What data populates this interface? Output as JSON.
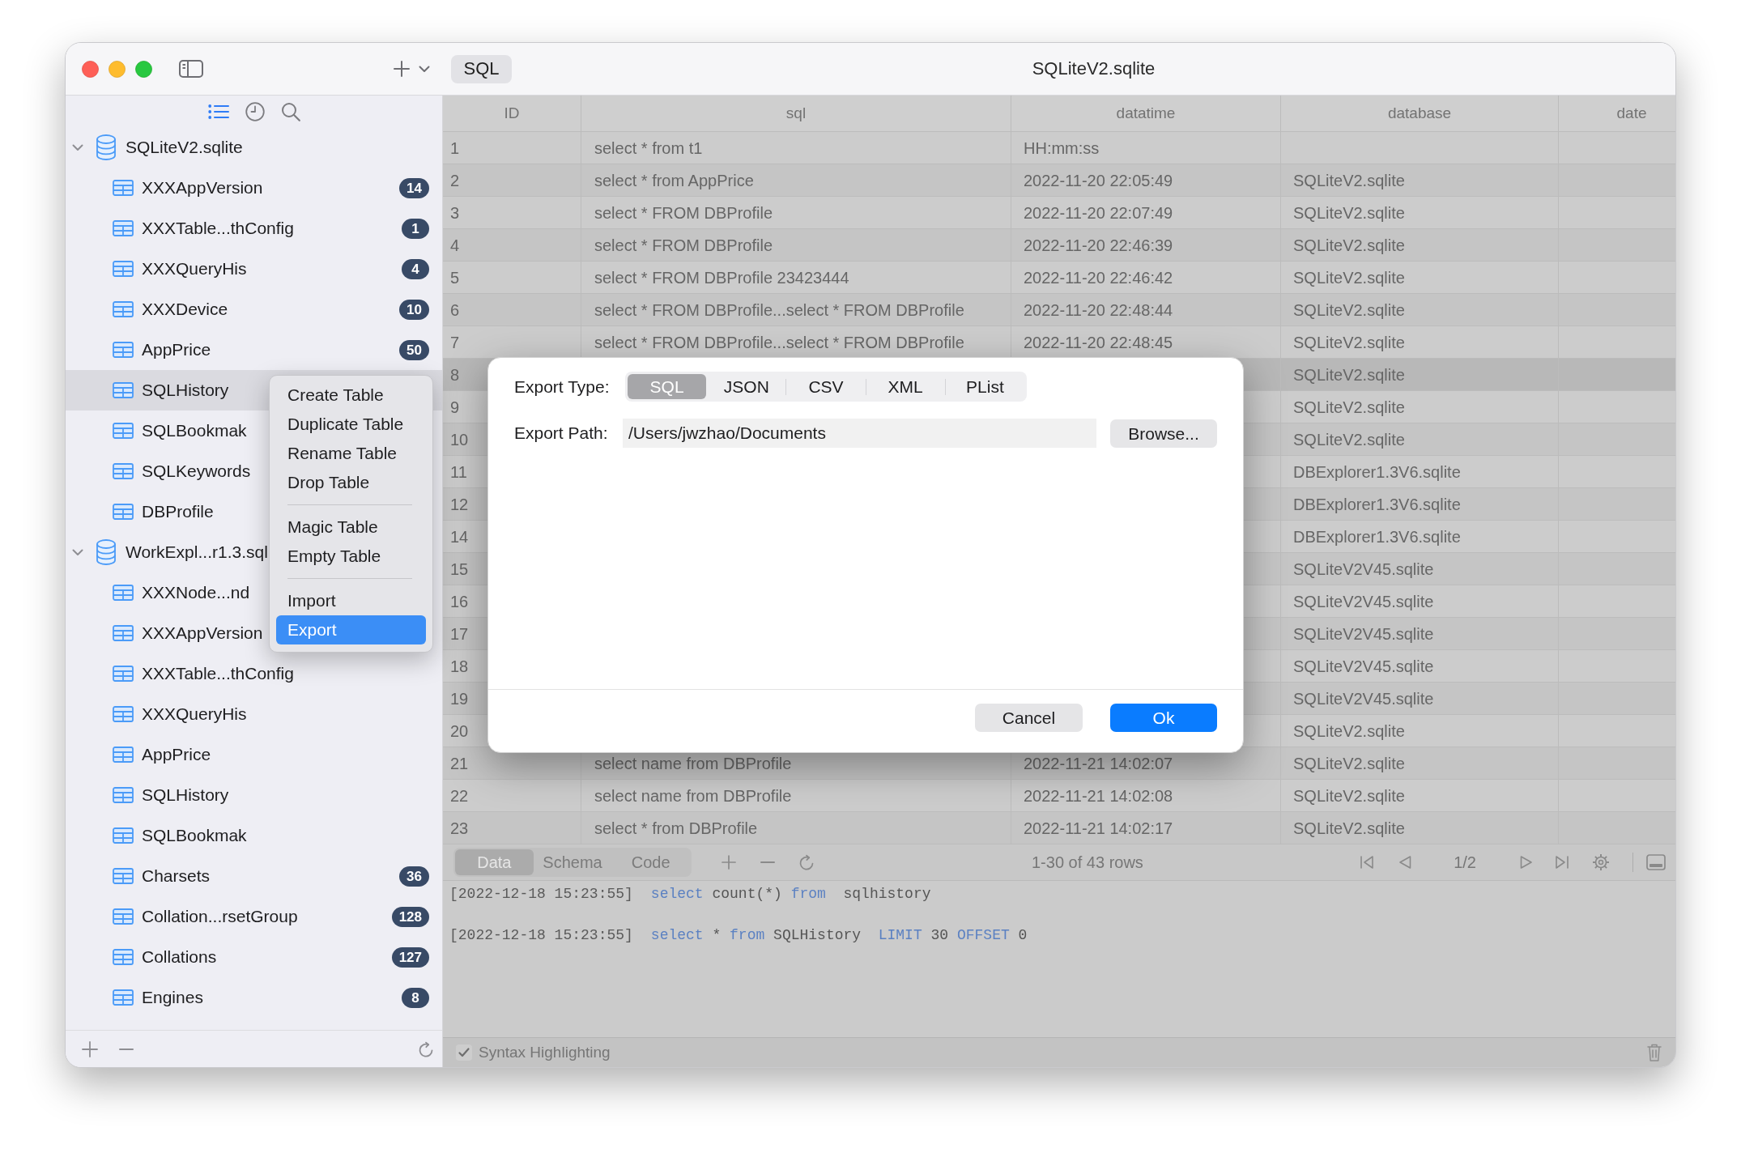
{
  "window": {
    "title": "SQLiteV2.sqlite",
    "sql_button": "SQL"
  },
  "sidebar": {
    "views": [
      {
        "selected": true
      },
      {
        "selected": false
      },
      {
        "selected": false
      }
    ],
    "tree": [
      {
        "label": "SQLiteV2.sqlite",
        "expanded": true,
        "selected": false,
        "children": [
          {
            "label": "XXXAppVersion",
            "count": "14",
            "selected": false
          },
          {
            "label": "XXXTable...thConfig",
            "count": "1",
            "selected": false
          },
          {
            "label": "XXXQueryHis",
            "count": "4",
            "selected": false
          },
          {
            "label": "XXXDevice",
            "count": "10",
            "selected": false
          },
          {
            "label": "AppPrice",
            "count": "50",
            "selected": false
          },
          {
            "label": "SQLHistory",
            "selected": true
          },
          {
            "label": "SQLBookmak",
            "selected": false
          },
          {
            "label": "SQLKeywords",
            "selected": false
          },
          {
            "label": "DBProfile",
            "selected": false
          }
        ]
      },
      {
        "label": "WorkExpl...r1.3.sql",
        "expanded": true,
        "selected": false,
        "children": [
          {
            "label": "XXXNode...nd",
            "selected": false
          },
          {
            "label": "XXXAppVersion",
            "selected": false
          },
          {
            "label": "XXXTable...thConfig",
            "selected": false
          },
          {
            "label": "XXXQueryHis",
            "selected": false
          },
          {
            "label": "AppPrice",
            "selected": false
          },
          {
            "label": "SQLHistory",
            "selected": false
          },
          {
            "label": "SQLBookmak",
            "selected": false
          },
          {
            "label": "Charsets",
            "count": "36",
            "selected": false
          },
          {
            "label": "Collation...rsetGroup",
            "count": "128",
            "selected": false
          },
          {
            "label": "Collations",
            "count": "127",
            "selected": false
          },
          {
            "label": "Engines",
            "count": "8",
            "selected": false
          }
        ]
      }
    ]
  },
  "context_menu": {
    "groups": [
      [
        {
          "label": "Create Table",
          "highlighted": false
        },
        {
          "label": "Duplicate Table",
          "highlighted": false
        },
        {
          "label": "Rename Table",
          "highlighted": false
        },
        {
          "label": "Drop Table",
          "highlighted": false
        }
      ],
      [
        {
          "label": "Magic Table",
          "highlighted": false
        },
        {
          "label": "Empty Table",
          "highlighted": false
        }
      ],
      [
        {
          "label": "Import",
          "highlighted": false
        },
        {
          "label": "Export",
          "highlighted": true
        }
      ]
    ]
  },
  "table": {
    "columns": [
      "ID",
      "sql",
      "datatime",
      "database",
      "date"
    ],
    "rows": [
      {
        "id": "1",
        "sql": "select * from t1",
        "datatime": "HH:mm:ss",
        "selected": false
      },
      {
        "id": "2",
        "sql": "select * from AppPrice",
        "datatime": "2022-11-20 22:05:49",
        "database": "SQLiteV2.sqlite",
        "selected": false
      },
      {
        "id": "3",
        "sql": "select * FROM DBProfile",
        "datatime": "2022-11-20 22:07:49",
        "database": "SQLiteV2.sqlite",
        "selected": false
      },
      {
        "id": "4",
        "sql": "select * FROM DBProfile",
        "datatime": "2022-11-20 22:46:39",
        "database": "SQLiteV2.sqlite",
        "selected": false
      },
      {
        "id": "5",
        "sql": "select * FROM DBProfile 23423444",
        "datatime": "2022-11-20 22:46:42",
        "database": "SQLiteV2.sqlite",
        "selected": false
      },
      {
        "id": "6",
        "sql": "select * FROM DBProfile...select * FROM DBProfile",
        "datatime": "2022-11-20 22:48:44",
        "database": "SQLiteV2.sqlite",
        "selected": false
      },
      {
        "id": "7",
        "sql": "select * FROM DBProfile...select * FROM DBProfile",
        "datatime": "2022-11-20 22:48:45",
        "database": "SQLiteV2.sqlite",
        "selected": false
      },
      {
        "id": "8",
        "database": "SQLiteV2.sqlite",
        "selected": true
      },
      {
        "id": "9",
        "database": "SQLiteV2.sqlite",
        "selected": false
      },
      {
        "id": "10",
        "database": "SQLiteV2.sqlite",
        "selected": false
      },
      {
        "id": "11",
        "database": "DBExplorer1.3V6.sqlite",
        "selected": false
      },
      {
        "id": "12",
        "database": "DBExplorer1.3V6.sqlite",
        "selected": false
      },
      {
        "id": "14",
        "database": "DBExplorer1.3V6.sqlite",
        "selected": false
      },
      {
        "id": "15",
        "database": "SQLiteV2V45.sqlite",
        "selected": false
      },
      {
        "id": "16",
        "database": "SQLiteV2V45.sqlite",
        "selected": false
      },
      {
        "id": "17",
        "database": "SQLiteV2V45.sqlite",
        "selected": false
      },
      {
        "id": "18",
        "database": "SQLiteV2V45.sqlite",
        "selected": false
      },
      {
        "id": "19",
        "database": "SQLiteV2V45.sqlite",
        "selected": false
      },
      {
        "id": "20",
        "database": "SQLiteV2.sqlite",
        "selected": false
      },
      {
        "id": "21",
        "sql": "select name from DBProfile",
        "datatime": "2022-11-21 14:02:07",
        "database": "SQLiteV2.sqlite",
        "selected": false
      },
      {
        "id": "22",
        "sql": "select name from DBProfile",
        "datatime": "2022-11-21 14:02:08",
        "database": "SQLiteV2.sqlite",
        "selected": false
      },
      {
        "id": "23",
        "sql": "select * from DBProfile",
        "datatime": "2022-11-21 14:02:17",
        "database": "SQLiteV2.sqlite",
        "selected": false
      }
    ]
  },
  "table_footer": {
    "tabs": [
      {
        "label": "Data",
        "selected": true
      },
      {
        "label": "Schema",
        "selected": false
      },
      {
        "label": "Code",
        "selected": false
      }
    ],
    "row_count": "1-30 of 43 rows",
    "page": "1/2"
  },
  "log": [
    {
      "time": "[2022-12-18 15:23:55]",
      "tokens": [
        {
          "text": "select",
          "kind": "keyword"
        },
        {
          "text": " count(*) ",
          "kind": "plain"
        },
        {
          "text": "from",
          "kind": "keyword"
        },
        {
          "text": "  sqlhistory",
          "kind": "plain"
        }
      ]
    },
    {
      "time": "[2022-12-18 15:23:55]",
      "tokens": [
        {
          "text": "select",
          "kind": "keyword"
        },
        {
          "text": " * ",
          "kind": "plain"
        },
        {
          "text": "from",
          "kind": "keyword"
        },
        {
          "text": " SQLHistory  ",
          "kind": "plain"
        },
        {
          "text": "LIMIT",
          "kind": "keyword"
        },
        {
          "text": " 30 ",
          "kind": "plain"
        },
        {
          "text": "OFFSET",
          "kind": "keyword"
        },
        {
          "text": " 0",
          "kind": "plain"
        }
      ]
    }
  ],
  "status_bar": {
    "syntax_highlighting": {
      "label": "Syntax Highlighting",
      "checked": true
    }
  },
  "export_dialog": {
    "type_label": "Export Type:",
    "types": [
      {
        "label": "SQL",
        "selected": true
      },
      {
        "label": "JSON",
        "selected": false
      },
      {
        "label": "CSV",
        "selected": false
      },
      {
        "label": "XML",
        "selected": false
      },
      {
        "label": "PList",
        "selected": false
      }
    ],
    "path_label": "Export Path:",
    "path": "/Users/jwzhao/Documents",
    "browse": "Browse...",
    "buttons": [
      {
        "label": "Cancel",
        "kind": "secondary"
      },
      {
        "label": "Ok",
        "kind": "primary"
      }
    ]
  }
}
